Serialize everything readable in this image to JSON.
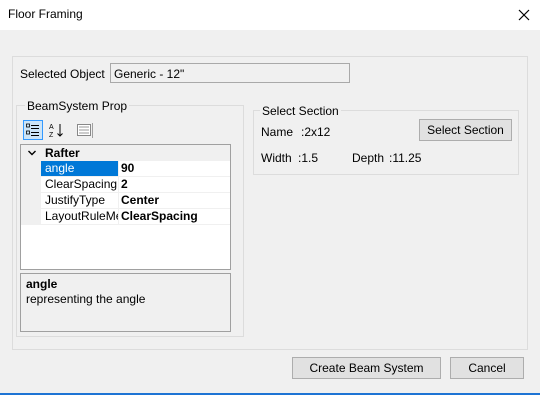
{
  "window": {
    "title": "Floor Framing"
  },
  "selected_object": {
    "label": "Selected Object",
    "value": "Generic - 12\""
  },
  "beam_system": {
    "group_label": "BeamSystem Prop",
    "category": "Rafter",
    "properties": [
      {
        "name": "angle",
        "value": "90"
      },
      {
        "name": "ClearSpacing",
        "value": "2"
      },
      {
        "name": "JustifyType",
        "value": "Center"
      },
      {
        "name": "LayoutRuleMet",
        "value": "ClearSpacing"
      }
    ],
    "description": {
      "title": "angle",
      "text": "representing the angle"
    }
  },
  "select_section": {
    "group_label": "Select Section",
    "name_label": "Name",
    "name_value": ":2x12",
    "width_label": "Width",
    "width_value": ":1.5",
    "depth_label": "Depth",
    "depth_value": ":11.25",
    "button_label": "Select Section"
  },
  "buttons": {
    "create": "Create Beam System",
    "cancel": "Cancel"
  },
  "icons": {
    "close": "close-icon",
    "categorized": "categorized-icon",
    "alphabetical": "sort-alphabetical-icon",
    "property_pages": "property-pages-icon",
    "collapse": "collapse-chevron-icon"
  },
  "colors": {
    "selection": "#0078d7",
    "accent": "#1e74d4"
  }
}
